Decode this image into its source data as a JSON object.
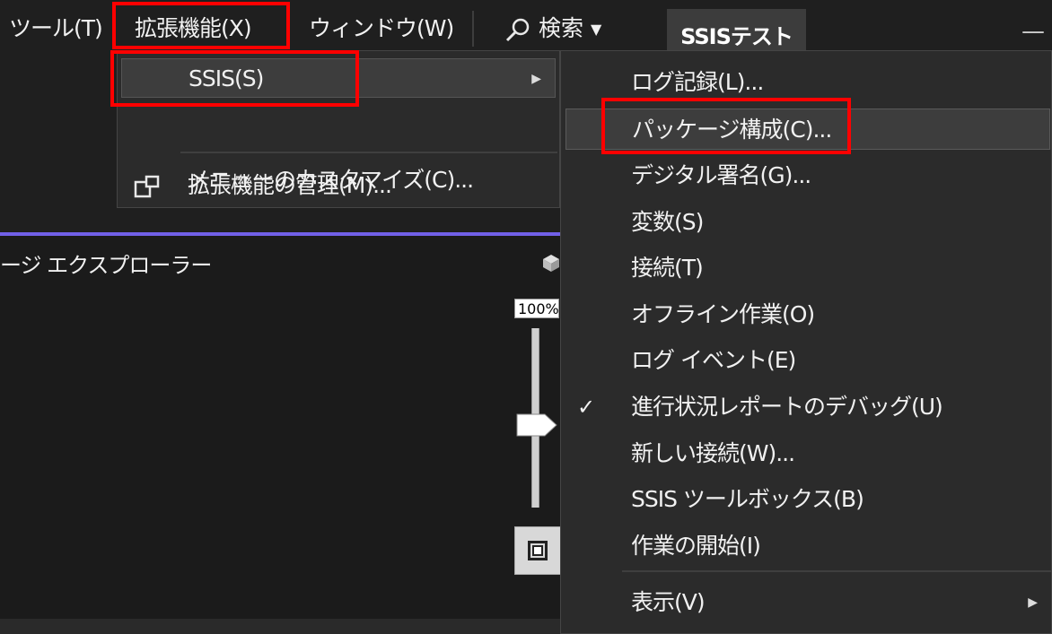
{
  "menubar": {
    "tools": "ツール(T)",
    "extensions": "拡張機能(X)",
    "window": "ウィンドウ(W)",
    "search": "検索",
    "search_icon": "search-icon",
    "window_title": "SSISテスト",
    "minimize": "—"
  },
  "explorer": {
    "title": "ージ エクスプローラー",
    "zoom_label": "100%",
    "zoom_level_percent": 100
  },
  "extensions_menu": {
    "ssis": "SSIS(S)",
    "manage": "拡張機能の管理(M)...",
    "customize": "メニューのカスタマイズ(C)..."
  },
  "ssis_menu": {
    "items": [
      {
        "label": "ログ記録(L)..."
      },
      {
        "label": "パッケージ構成(C)..."
      },
      {
        "label": "デジタル署名(G)..."
      },
      {
        "label": "変数(S)"
      },
      {
        "label": "接続(T)"
      },
      {
        "label": "オフライン作業(O)"
      },
      {
        "label": "ログ イベント(E)"
      },
      {
        "label": "進行状況レポートのデバッグ(U)",
        "checked": true
      },
      {
        "label": "新しい接続(W)..."
      },
      {
        "label": "SSIS ツールボックス(B)"
      },
      {
        "label": "作業の開始(I)"
      },
      {
        "label": "表示(V)"
      }
    ]
  },
  "colors": {
    "highlight": "#ff0000",
    "accent": "#7160e8",
    "menu_bg": "#2b2b2b"
  }
}
